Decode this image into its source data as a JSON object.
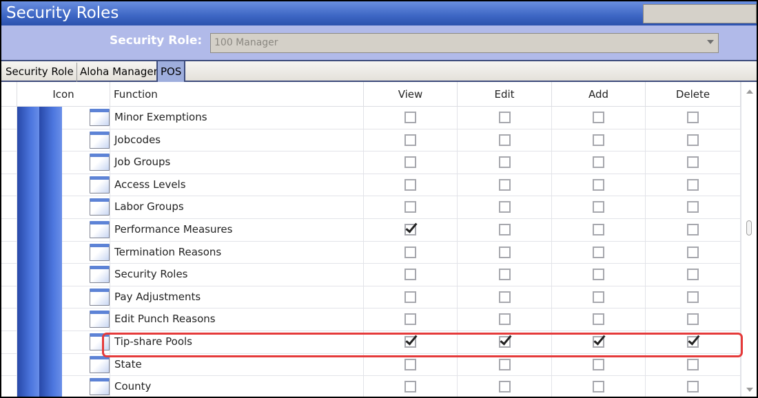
{
  "window": {
    "title": "Security Roles"
  },
  "role_selector": {
    "label": "Security Role:",
    "value": "100  Manager"
  },
  "tabs": [
    {
      "label": "Security Role",
      "active": false
    },
    {
      "label": "Aloha Manager",
      "active": false
    },
    {
      "label": "POS",
      "active": true
    }
  ],
  "grid": {
    "columns": {
      "icon": "Icon",
      "function": "Function",
      "view": "View",
      "edit": "Edit",
      "add": "Add",
      "delete": "Delete"
    },
    "rows": [
      {
        "function": "Minor Exemptions",
        "view": false,
        "edit": false,
        "add": false,
        "delete": false
      },
      {
        "function": "Jobcodes",
        "view": false,
        "edit": false,
        "add": false,
        "delete": false
      },
      {
        "function": "Job Groups",
        "view": false,
        "edit": false,
        "add": false,
        "delete": false
      },
      {
        "function": "Access Levels",
        "view": false,
        "edit": false,
        "add": false,
        "delete": false
      },
      {
        "function": "Labor Groups",
        "view": false,
        "edit": false,
        "add": false,
        "delete": false
      },
      {
        "function": "Performance Measures",
        "view": true,
        "edit": false,
        "add": false,
        "delete": false
      },
      {
        "function": "Termination Reasons",
        "view": false,
        "edit": false,
        "add": false,
        "delete": false
      },
      {
        "function": "Security Roles",
        "view": false,
        "edit": false,
        "add": false,
        "delete": false
      },
      {
        "function": "Pay Adjustments",
        "view": false,
        "edit": false,
        "add": false,
        "delete": false
      },
      {
        "function": "Edit Punch Reasons",
        "view": false,
        "edit": false,
        "add": false,
        "delete": false
      },
      {
        "function": "Tip-share Pools",
        "view": true,
        "edit": true,
        "add": true,
        "delete": true,
        "highlighted": true
      },
      {
        "function": "State",
        "view": false,
        "edit": false,
        "add": false,
        "delete": false
      },
      {
        "function": "County",
        "view": false,
        "edit": false,
        "add": false,
        "delete": false
      }
    ]
  },
  "colors": {
    "title_bar": "#3d66c4",
    "role_bar": "#b1bae9",
    "highlight": "#e53a3a"
  }
}
